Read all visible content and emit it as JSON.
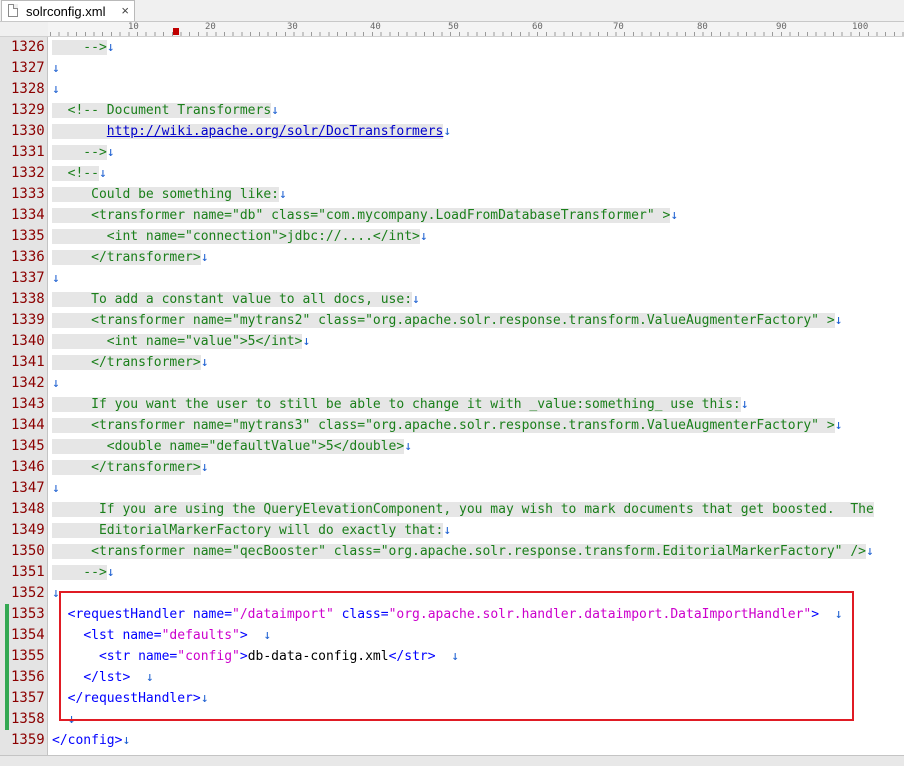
{
  "tab": {
    "filename": "solrconfig.xml",
    "close": "×"
  },
  "ruler": {
    "numbers": [
      "10",
      "20",
      "30",
      "40",
      "50",
      "60",
      "70",
      "80",
      "90",
      "100"
    ]
  },
  "eol_glyph": "↓",
  "lines": [
    {
      "n": "1326",
      "segs": [
        {
          "t": "    -->",
          "c": "cm"
        },
        {
          "t": "↓",
          "c": "eol"
        }
      ]
    },
    {
      "n": "1327",
      "segs": [
        {
          "t": "↓",
          "c": "eol"
        }
      ]
    },
    {
      "n": "1328",
      "segs": [
        {
          "t": "↓",
          "c": "eol"
        }
      ]
    },
    {
      "n": "1329",
      "segs": [
        {
          "t": "  <!-- Document Transformers",
          "c": "cm"
        },
        {
          "t": "↓",
          "c": "eol"
        }
      ]
    },
    {
      "n": "1330",
      "segs": [
        {
          "t": "       ",
          "c": "cm"
        },
        {
          "t": "http://wiki.apache.org/solr/DocTransformers",
          "c": "cm url"
        },
        {
          "t": "↓",
          "c": "eol"
        }
      ]
    },
    {
      "n": "1331",
      "segs": [
        {
          "t": "    -->",
          "c": "cm"
        },
        {
          "t": "↓",
          "c": "eol"
        }
      ]
    },
    {
      "n": "1332",
      "segs": [
        {
          "t": "  <!--",
          "c": "cm"
        },
        {
          "t": "↓",
          "c": "eol"
        }
      ]
    },
    {
      "n": "1333",
      "segs": [
        {
          "t": "     Could be something like:",
          "c": "cm"
        },
        {
          "t": "↓",
          "c": "eol"
        }
      ]
    },
    {
      "n": "1334",
      "segs": [
        {
          "t": "     <transformer name=\"db\" class=\"com.mycompany.LoadFromDatabaseTransformer\" >",
          "c": "cm"
        },
        {
          "t": "↓",
          "c": "eol"
        }
      ]
    },
    {
      "n": "1335",
      "segs": [
        {
          "t": "       <int name=\"connection\">jdbc://....</int>",
          "c": "cm"
        },
        {
          "t": "↓",
          "c": "eol"
        }
      ]
    },
    {
      "n": "1336",
      "segs": [
        {
          "t": "     </transformer>",
          "c": "cm"
        },
        {
          "t": "↓",
          "c": "eol"
        }
      ]
    },
    {
      "n": "1337",
      "segs": [
        {
          "t": "↓",
          "c": "eol"
        }
      ]
    },
    {
      "n": "1338",
      "segs": [
        {
          "t": "     To add a constant value to all docs, use:",
          "c": "cm"
        },
        {
          "t": "↓",
          "c": "eol"
        }
      ]
    },
    {
      "n": "1339",
      "segs": [
        {
          "t": "     <transformer name=\"mytrans2\" class=\"org.apache.solr.response.transform.ValueAugmenterFactory\" >",
          "c": "cm"
        },
        {
          "t": "↓",
          "c": "eol"
        }
      ]
    },
    {
      "n": "1340",
      "segs": [
        {
          "t": "       <int name=\"value\">5</int>",
          "c": "cm"
        },
        {
          "t": "↓",
          "c": "eol"
        }
      ]
    },
    {
      "n": "1341",
      "segs": [
        {
          "t": "     </transformer>",
          "c": "cm"
        },
        {
          "t": "↓",
          "c": "eol"
        }
      ]
    },
    {
      "n": "1342",
      "segs": [
        {
          "t": "↓",
          "c": "eol"
        }
      ]
    },
    {
      "n": "1343",
      "segs": [
        {
          "t": "     If you want the user to still be able to change it with _value:something_ use this:",
          "c": "cm"
        },
        {
          "t": "↓",
          "c": "eol"
        }
      ]
    },
    {
      "n": "1344",
      "segs": [
        {
          "t": "     <transformer name=\"mytrans3\" class=\"org.apache.solr.response.transform.ValueAugmenterFactory\" >",
          "c": "cm"
        },
        {
          "t": "↓",
          "c": "eol"
        }
      ]
    },
    {
      "n": "1345",
      "segs": [
        {
          "t": "       <double name=\"defaultValue\">5</double>",
          "c": "cm"
        },
        {
          "t": "↓",
          "c": "eol"
        }
      ]
    },
    {
      "n": "1346",
      "segs": [
        {
          "t": "     </transformer>",
          "c": "cm"
        },
        {
          "t": "↓",
          "c": "eol"
        }
      ]
    },
    {
      "n": "1347",
      "segs": [
        {
          "t": "↓",
          "c": "eol"
        }
      ]
    },
    {
      "n": "1348",
      "segs": [
        {
          "t": "      If you are using the QueryElevationComponent, you may wish to mark documents that get boosted.  The",
          "c": "cm"
        }
      ]
    },
    {
      "n": "1349",
      "segs": [
        {
          "t": "      EditorialMarkerFactory will do exactly that:",
          "c": "cm"
        },
        {
          "t": "↓",
          "c": "eol"
        }
      ]
    },
    {
      "n": "1350",
      "segs": [
        {
          "t": "     <transformer name=\"qecBooster\" class=\"org.apache.solr.response.transform.EditorialMarkerFactory\" />",
          "c": "cm"
        },
        {
          "t": "↓",
          "c": "eol"
        }
      ]
    },
    {
      "n": "1351",
      "segs": [
        {
          "t": "    -->",
          "c": "cm"
        },
        {
          "t": "↓",
          "c": "eol"
        }
      ]
    },
    {
      "n": "1352",
      "segs": [
        {
          "t": "↓",
          "c": "eol"
        }
      ]
    },
    {
      "n": "1353",
      "segs": [
        {
          "t": "  ",
          "c": ""
        },
        {
          "t": "<requestHandler",
          "c": "tagc"
        },
        {
          "t": " name=",
          "c": "attr"
        },
        {
          "t": "\"/dataimport\"",
          "c": "val"
        },
        {
          "t": " class=",
          "c": "attr"
        },
        {
          "t": "\"org.apache.solr.handler.dataimport.DataImportHandler\"",
          "c": "val"
        },
        {
          "t": ">",
          "c": "tagc"
        },
        {
          "t": "  ↓",
          "c": "eol"
        }
      ]
    },
    {
      "n": "1354",
      "segs": [
        {
          "t": "    ",
          "c": ""
        },
        {
          "t": "<lst",
          "c": "tagc"
        },
        {
          "t": " name=",
          "c": "attr"
        },
        {
          "t": "\"defaults\"",
          "c": "val"
        },
        {
          "t": ">",
          "c": "tagc"
        },
        {
          "t": "  ↓",
          "c": "eol"
        }
      ]
    },
    {
      "n": "1355",
      "segs": [
        {
          "t": "      ",
          "c": ""
        },
        {
          "t": "<str",
          "c": "tagc"
        },
        {
          "t": " name=",
          "c": "attr"
        },
        {
          "t": "\"config\"",
          "c": "val"
        },
        {
          "t": ">",
          "c": "tagc"
        },
        {
          "t": "db-data-config.xml",
          "c": ""
        },
        {
          "t": "</str>",
          "c": "tagc"
        },
        {
          "t": "  ↓",
          "c": "eol"
        }
      ]
    },
    {
      "n": "1356",
      "segs": [
        {
          "t": "    ",
          "c": ""
        },
        {
          "t": "</lst>",
          "c": "tagc"
        },
        {
          "t": "  ↓",
          "c": "eol"
        }
      ]
    },
    {
      "n": "1357",
      "segs": [
        {
          "t": "  ",
          "c": ""
        },
        {
          "t": "</requestHandler>",
          "c": "tagc"
        },
        {
          "t": "↓",
          "c": "eol"
        }
      ]
    },
    {
      "n": "1358",
      "segs": [
        {
          "t": "  ↓",
          "c": "eol"
        }
      ]
    },
    {
      "n": "1359",
      "segs": [
        {
          "t": "</config>",
          "c": "tagc"
        },
        {
          "t": "↓",
          "c": "eol"
        }
      ]
    }
  ],
  "colors": {
    "highlight_box": "#e01b24",
    "change_bar": "#34a853",
    "comment": "#1a7f1a",
    "line_number": "#8b0000"
  }
}
